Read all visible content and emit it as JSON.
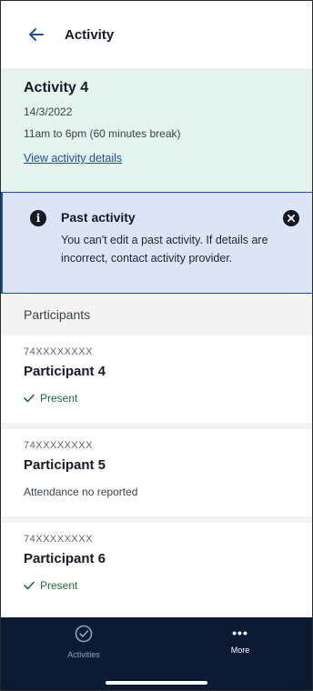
{
  "header": {
    "title": "Activity"
  },
  "activity": {
    "title": "Activity 4",
    "date": "14/3/2022",
    "time": "11am to 6pm (60 minutes break)",
    "link": "View activity details"
  },
  "alert": {
    "title": "Past activity",
    "body": "You can't edit a past activity. If details are incorrect, contact activity provider."
  },
  "participants": {
    "heading": "Participants",
    "items": [
      {
        "id": "74XXXXXXXX",
        "name": "Participant 4",
        "status": "Present"
      },
      {
        "id": "74XXXXXXXX",
        "name": "Participant 5",
        "status": "Attendance no reported"
      },
      {
        "id": "74XXXXXXXX",
        "name": "Participant 6",
        "status": "Present"
      }
    ]
  },
  "nav": {
    "activities": "Activities",
    "more": "More"
  },
  "colors": {
    "accent": "#1c4f9c",
    "activity_bg": "#e5f3ef",
    "alert_bg": "#dbe5f5",
    "nav_bg": "#0d1a33",
    "present": "#1e6b3a"
  },
  "icons": [
    "back-arrow-icon",
    "info-icon",
    "close-icon",
    "check-icon",
    "check-circle-icon",
    "more-dots-icon"
  ]
}
